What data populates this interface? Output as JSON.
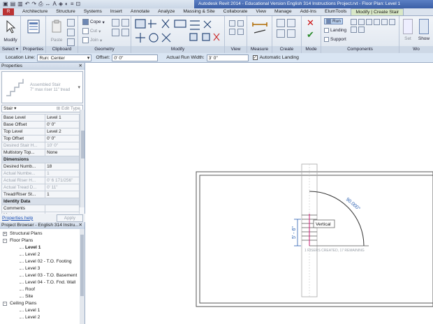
{
  "window": {
    "title": "Autodesk Revit 2014 - Educational Version     English 314 Instructions Project.rvt - Floor Plan: Level 1"
  },
  "ribbon_tabs": [
    {
      "label": "Architecture"
    },
    {
      "label": "Structure"
    },
    {
      "label": "Systems"
    },
    {
      "label": "Insert"
    },
    {
      "label": "Annotate"
    },
    {
      "label": "Analyze"
    },
    {
      "label": "Massing & Site"
    },
    {
      "label": "Collaborate"
    },
    {
      "label": "View"
    },
    {
      "label": "Manage"
    },
    {
      "label": "Add-Ins"
    },
    {
      "label": "ElumTools"
    },
    {
      "label": "Modify | Create Stair"
    }
  ],
  "ribbon": {
    "modify_label": "Modify",
    "paste_label": "Paste",
    "properties_label": "Properties",
    "cope_label": "Cope",
    "cut_label": "Cut",
    "join_label": "Join",
    "run_label": "Run",
    "landing_label": "Landing",
    "support_label": "Support",
    "set_label": "Set",
    "show_label": "Show",
    "panels": {
      "select": "Select",
      "properties": "Properties",
      "clipboard": "Clipboard",
      "geometry": "Geometry",
      "modify": "Modify",
      "view": "View",
      "measure": "Measure",
      "create": "Create",
      "mode": "Mode",
      "components": "Components",
      "wo": "Wo"
    }
  },
  "options_bar": {
    "location_line_label": "Location Line:",
    "location_line_value": "Run: Center",
    "offset_label": "Offset:",
    "offset_value": "0'  0\"",
    "run_width_label": "Actual Run Width:",
    "run_width_value": "3'  0\"",
    "auto_landing_label": "Automatic Landing",
    "auto_landing_checked": true
  },
  "properties": {
    "header": "Properties",
    "type_name_line1": "Assembled Stair",
    "type_name_line2": "7\" max riser 11\" tread",
    "instance_filter": "Stair",
    "edit_type": "Edit Type",
    "rows": [
      {
        "k": "Base Level",
        "v": "Level 1",
        "dis": false
      },
      {
        "k": "Base Offset",
        "v": "0'  0\"",
        "dis": false
      },
      {
        "k": "Top Level",
        "v": "Level 2",
        "dis": false
      },
      {
        "k": "Top Offset",
        "v": "0'  0\"",
        "dis": false
      },
      {
        "k": "Desired Stair H...",
        "v": "10'  0\"",
        "dis": true
      },
      {
        "k": "Multistory Top...",
        "v": "None",
        "dis": false
      },
      {
        "k": "Dimensions",
        "v": "",
        "group": true
      },
      {
        "k": "Desired Numb...",
        "v": "18",
        "dis": false
      },
      {
        "k": "Actual Numbe...",
        "v": "1",
        "dis": true
      },
      {
        "k": "Actual Riser H...",
        "v": "0'  6 171/256\"",
        "dis": true
      },
      {
        "k": "Actual Tread D...",
        "v": "0'  11\"",
        "dis": true
      },
      {
        "k": "Tread/Riser St...",
        "v": "1",
        "dis": false
      },
      {
        "k": "Identity Data",
        "v": "",
        "group": true
      },
      {
        "k": "Comments",
        "v": "",
        "dis": false
      },
      {
        "k": "Mark",
        "v": "",
        "dis": false
      }
    ],
    "help_link": "Properties help",
    "apply": "Apply"
  },
  "project_browser": {
    "header": "Project Browser - English 314 Instru...",
    "nodes": [
      {
        "label": "Structural Plans",
        "level": 1,
        "toggle": "+"
      },
      {
        "label": "Floor Plans",
        "level": 1,
        "toggle": "-"
      },
      {
        "label": "Level 1",
        "level": 2,
        "selected": true
      },
      {
        "label": "Level 2",
        "level": 2
      },
      {
        "label": "Level 02 - T.O. Footing",
        "level": 2
      },
      {
        "label": "Level 3",
        "level": 2
      },
      {
        "label": "Level 03 - T.O. Basement",
        "level": 2
      },
      {
        "label": "Level 04 - T.O. Fnd. Wall",
        "level": 2
      },
      {
        "label": "Roof",
        "level": 2
      },
      {
        "label": "Site",
        "level": 2
      },
      {
        "label": "Ceiling Plans",
        "level": 1,
        "toggle": "-"
      },
      {
        "label": "Level 1",
        "level": 2
      },
      {
        "label": "Level 2",
        "level": 2
      }
    ]
  },
  "canvas": {
    "radius_dim": "90.000°",
    "height_dim": "5' - 6\"",
    "tooltip": "Vertical",
    "riser_readout": "1 RISERS CREATED, 17 REMAINING"
  }
}
